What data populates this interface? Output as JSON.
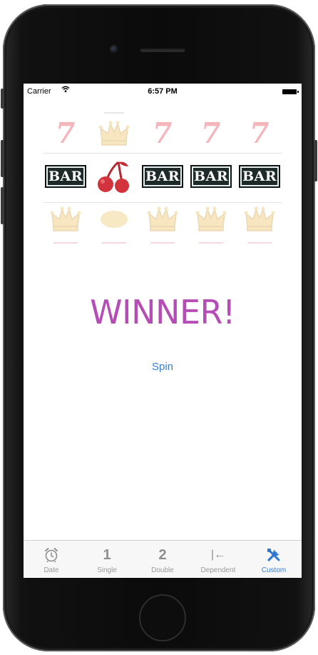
{
  "status_bar": {
    "carrier": "Carrier",
    "time": "6:57 PM"
  },
  "slot_machine": {
    "reels": [
      {
        "top": "seven",
        "middle": "bar",
        "bottom": "crown"
      },
      {
        "top": "crown",
        "middle": "cherry",
        "bottom": "lemon"
      },
      {
        "top": "seven",
        "middle": "bar",
        "bottom": "crown"
      },
      {
        "top": "seven",
        "middle": "bar",
        "bottom": "crown"
      },
      {
        "top": "seven",
        "middle": "bar",
        "bottom": "crown"
      }
    ],
    "bar_label": "BAR",
    "seven_label": "7"
  },
  "result": {
    "text": "WINNER!",
    "color": "#b64db6"
  },
  "spin_button": {
    "label": "Spin",
    "color": "#3a7fd8"
  },
  "tab_bar": {
    "active_color": "#3a7fd8",
    "tabs": [
      {
        "label": "Date",
        "icon": "alarm-clock-icon",
        "glyph": ""
      },
      {
        "label": "Single",
        "icon": "number-one-icon",
        "glyph": "1"
      },
      {
        "label": "Double",
        "icon": "number-two-icon",
        "glyph": "2"
      },
      {
        "label": "Dependent",
        "icon": "dependent-arrow-icon",
        "glyph": "|←"
      },
      {
        "label": "Custom",
        "icon": "tools-icon",
        "glyph": "",
        "active": true
      }
    ]
  }
}
